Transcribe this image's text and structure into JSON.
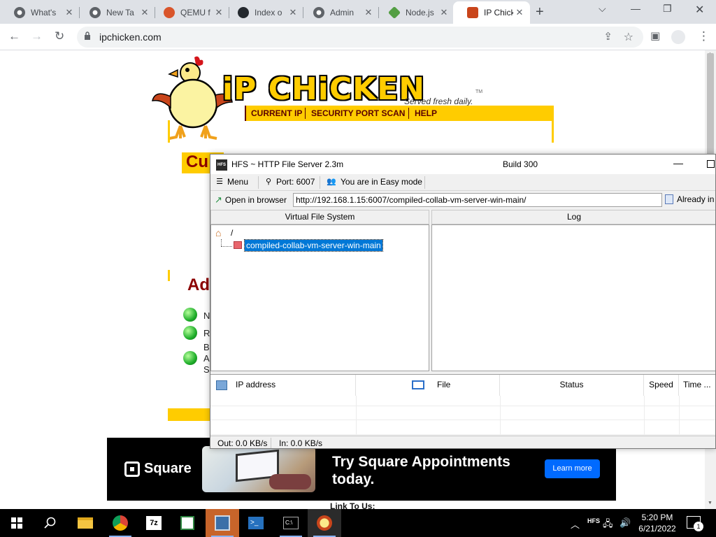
{
  "browser": {
    "tabs": [
      {
        "title": "What's",
        "favicon": "chrome-icon",
        "color": "#5f6368"
      },
      {
        "title": "New Ta",
        "favicon": "chrome-icon",
        "color": "#5f6368"
      },
      {
        "title": "QEMU f",
        "favicon": "qemu-icon",
        "color": "#d9552b"
      },
      {
        "title": "Index o",
        "favicon": "github-icon",
        "color": "#24292e"
      },
      {
        "title": "Admin",
        "favicon": "globe-icon",
        "color": "#5f6368"
      },
      {
        "title": "Node.js",
        "favicon": "nodejs-icon",
        "color": "#539e43"
      },
      {
        "title": "IP Chick",
        "favicon": "chicken-icon",
        "color": "#c9451b"
      }
    ],
    "url": "ipchicken.com"
  },
  "page": {
    "logo_text": "iP CHiCKEN",
    "tagline": "Served fresh daily.",
    "tm": "TM",
    "nav": [
      "CURRENT IP",
      "SECURITY PORT SCAN",
      "HELP"
    ],
    "heading_current": "Cu",
    "heading_add": "Ad",
    "list_letters": [
      "N",
      "R",
      "B",
      "A",
      "S"
    ],
    "link_to": "Link To Us:"
  },
  "ad": {
    "brand": "Square",
    "headline": "Try Square Appointments today.",
    "cta": "Learn more",
    "cta_color": "#006aff"
  },
  "hfs": {
    "title": "HFS ~ HTTP File Server 2.3m",
    "build": "Build 300",
    "menu": "Menu",
    "port": "Port: 6007",
    "mode": "You are in Easy mode",
    "open_in_browser": "Open in browser",
    "url": "http://192.168.1.15:6007/compiled-collab-vm-server-win-main/",
    "already": "Already in",
    "vfs_header": "Virtual File System",
    "log_header": "Log",
    "tree_root": "/",
    "tree_item": "compiled-collab-vm-server-win-main",
    "columns": [
      "IP address",
      "File",
      "Status",
      "Speed",
      "Time ..."
    ],
    "status_out": "Out: 0.0 KB/s",
    "status_in": "In: 0.0 KB/s"
  },
  "taskbar": {
    "apps": [
      "start-icon",
      "search-icon",
      "file-explorer-icon",
      "chrome-icon",
      "7zip-icon",
      "notepad-icon",
      "hfs-icon",
      "powershell-icon",
      "cmd-icon",
      "chicken-icon"
    ],
    "time": "5:20 PM",
    "date": "6/21/2022",
    "notifications": "1"
  }
}
